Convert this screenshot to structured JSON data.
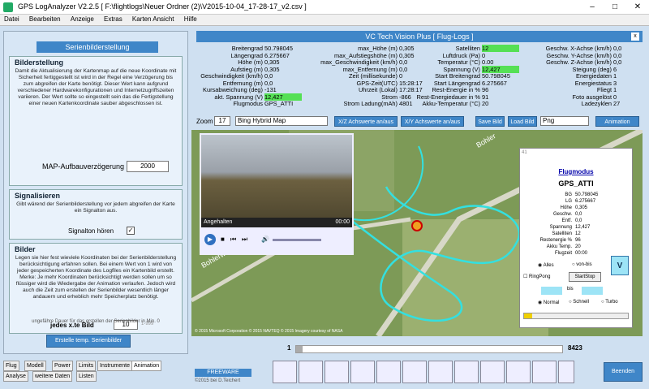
{
  "app": {
    "title": "GPS LogAnalyzer V2.2.5    [ F:\\flightlogs\\Neuer Ordner (2)\\V2015-10-04_17-28-17_v2.csv ]"
  },
  "menu": [
    "Datei",
    "Bearbeiten",
    "Anzeige",
    "Extras",
    "Karten Ansicht",
    "Hilfe"
  ],
  "left": {
    "header": "Serienbilderstellung",
    "bild": {
      "title": "Bilderstellung",
      "text": "Damit die Aktualisierung der Kartenmap auf die neue Koordinate mit Sicherheit fertiggestellt ist wird in der Regel eine Verzögerung bis zum abgreifen der Karte benötigt. Dieser Wert kann aufgrund verschiedener Hardwarekonfigurationen und Internetzugriffszeiten variieren. Der Wert sollte so eingestellt sein das die Fertigstellung einer neuen Kartenkoordinate sauber abgeschlossen ist.",
      "delay_label": "MAP-Aufbauverzögerung",
      "delay_value": "2000"
    },
    "signal": {
      "title": "Signalisieren",
      "text": "Gibt wärend der Serienbilderstellung vor jedem abgreifen der Karte ein Signalton aus.",
      "label": "Signalton hören"
    },
    "bilder": {
      "title": "Bilder",
      "text": "Legen sie hier fest wieviele Koordinaten bei der Serienbilderstellung berücksichtigung erfahren sollen. Bei einem Wert von 1 wird von jeder gespeicherten Koordinate des Logfiles ein Kartenbild erstellt. Merke: Je mehr Koordinaten berücksichtigt werden sollen um so flüssiger wird die Wiedergabe der Animation verlaufen. Jedoch wird auch die Zeit zum erstellen der Serienbilder wesentlich länger andauern und erheblich mehr Speicherplatz benötigt.",
      "jedes_label": "jedes x.te Bild",
      "jedes_value": "10",
      "range": "1-999"
    },
    "duration_note": "ungefähre Dauer für das erstellen der Serienbilder in Min. 0",
    "create_btn": "Erstelle temp. Serienbilder",
    "tabs_row1": [
      "Flug",
      "Modell",
      "Power",
      "Limits",
      "Instrumente",
      "Animation"
    ],
    "tabs_row2": [
      "Analyse",
      "weitere Daten",
      "Listen"
    ]
  },
  "main": {
    "header": "VC Tech Vision Plus [ Flug-Logs ]",
    "col1": [
      [
        "Breitengrad",
        "50.798045"
      ],
      [
        "Längengrad",
        "6.275667"
      ],
      [
        "Höhe (m)",
        "0,305"
      ],
      [
        "Aufstieg (m)",
        "0,305"
      ],
      [
        "Geschwindigkeit (km/h)",
        "0,0"
      ],
      [
        "Entfernung (m)",
        "0,0"
      ],
      [
        "Kursabweichung (deg)",
        "-131"
      ],
      [
        "akt. Spannung (V)",
        "12,427"
      ],
      [
        "Flugmodus",
        "GPS_ATTI"
      ]
    ],
    "col2": [
      [
        "max_Höhe (m)",
        "0,305"
      ],
      [
        "max_Aufstiegshöhe (m)",
        "0,305"
      ],
      [
        "max_Geschwindigkeit (km/h)",
        "0,0"
      ],
      [
        "max_Entfernung (m)",
        "0,0"
      ],
      [
        "Zeit (millisekunde)",
        "0"
      ],
      [
        "GPS-Zeit(UTC)",
        "15:28:17"
      ],
      [
        "Uhrzeit (Lokal)",
        "17:28:17"
      ],
      [
        "Strom",
        "-866"
      ],
      [
        "Strom Ladung(mAh)",
        "4801"
      ]
    ],
    "col3": [
      [
        "Satelliten",
        "12"
      ],
      [
        "Luftdruck (Pa)",
        "0"
      ],
      [
        "Temperatur (°C)",
        "0.00"
      ],
      [
        "Spannung (V)",
        "12,427"
      ],
      [
        "Start Breitengrad",
        "50.798045"
      ],
      [
        "Start Längengrad",
        "6.275667"
      ],
      [
        "Rest-Energie in %",
        "96"
      ],
      [
        "Rest-Energiedauer in %",
        "91"
      ],
      [
        "Akku-Temperatur (°C)",
        "20"
      ]
    ],
    "col4": [
      [
        "Geschw. X-Achse (km/h)",
        "0,0"
      ],
      [
        "Geschw. Y-Achse (km/h)",
        "0,0"
      ],
      [
        "Geschw. Z-Achse (km/h)",
        "0,0"
      ],
      [
        "Steigung (deg)",
        "6"
      ],
      [
        "Energiedaten",
        "1"
      ],
      [
        "Energiestatus",
        "3"
      ],
      [
        "Fliegt",
        "1"
      ],
      [
        "Foto ausgelöst",
        "0"
      ],
      [
        "Ladezyklen",
        "27"
      ]
    ],
    "toolbar": {
      "zoom_label": "Zoom",
      "zoom_value": "17",
      "map_type": "Bing Hybrid Map",
      "x_axis": "X/Z Achswerte an/aus",
      "xy_axis": "X/Y Achswerte an/aus",
      "save": "Save Bild",
      "load": "Load Bild",
      "format": "Png",
      "animation": "Animation"
    },
    "video": {
      "state": "Angehalten",
      "time": "00:00"
    },
    "map_labels": {
      "road1": "Bohlerweg",
      "road2": "Bohler",
      "copyright": "© 2015 Microsoft Corporation  © 2015 NAVTEQ  © 2015 Imagery courtesy of NASA"
    },
    "info": {
      "title": "Flugmodus",
      "mode": "GPS_ATTI",
      "rows": [
        [
          "BG",
          "50.798045"
        ],
        [
          "LG",
          "6.275667"
        ],
        [
          "Höhe",
          "0,305"
        ],
        [
          "Geschw.",
          "0,0"
        ],
        [
          "Entf.",
          "0,0"
        ],
        [
          "Spannung",
          "12,427"
        ],
        [
          "Satelliten",
          "12"
        ],
        [
          "Restenergie %",
          "96"
        ],
        [
          "Akku Temp.",
          "20"
        ],
        [
          "Flugzeit",
          "00:00"
        ]
      ],
      "alle": "Alles",
      "vonbis": "von-bis",
      "pingpong": "RingPong",
      "startstop": "StartStop",
      "bis": "bis",
      "normal": "Normal",
      "schnell": "Schnell",
      "turbo": "Turbo",
      "v": "V",
      "frame_top": "41"
    },
    "slider": {
      "start": "1",
      "end": "8423"
    },
    "freeware": "FREEWARE",
    "copyright": "©2015  bei D.Teichert",
    "beenden": "Beenden"
  }
}
